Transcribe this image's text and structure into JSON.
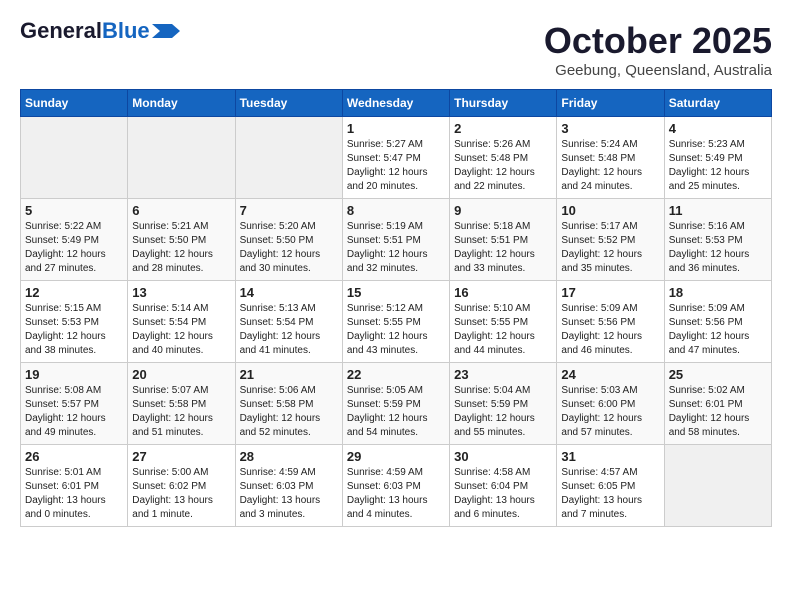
{
  "header": {
    "logo_general": "General",
    "logo_blue": "Blue",
    "month": "October 2025",
    "location": "Geebung, Queensland, Australia"
  },
  "days_of_week": [
    "Sunday",
    "Monday",
    "Tuesday",
    "Wednesday",
    "Thursday",
    "Friday",
    "Saturday"
  ],
  "weeks": [
    [
      {
        "day": "",
        "info": ""
      },
      {
        "day": "",
        "info": ""
      },
      {
        "day": "",
        "info": ""
      },
      {
        "day": "1",
        "info": "Sunrise: 5:27 AM\nSunset: 5:47 PM\nDaylight: 12 hours\nand 20 minutes."
      },
      {
        "day": "2",
        "info": "Sunrise: 5:26 AM\nSunset: 5:48 PM\nDaylight: 12 hours\nand 22 minutes."
      },
      {
        "day": "3",
        "info": "Sunrise: 5:24 AM\nSunset: 5:48 PM\nDaylight: 12 hours\nand 24 minutes."
      },
      {
        "day": "4",
        "info": "Sunrise: 5:23 AM\nSunset: 5:49 PM\nDaylight: 12 hours\nand 25 minutes."
      }
    ],
    [
      {
        "day": "5",
        "info": "Sunrise: 5:22 AM\nSunset: 5:49 PM\nDaylight: 12 hours\nand 27 minutes."
      },
      {
        "day": "6",
        "info": "Sunrise: 5:21 AM\nSunset: 5:50 PM\nDaylight: 12 hours\nand 28 minutes."
      },
      {
        "day": "7",
        "info": "Sunrise: 5:20 AM\nSunset: 5:50 PM\nDaylight: 12 hours\nand 30 minutes."
      },
      {
        "day": "8",
        "info": "Sunrise: 5:19 AM\nSunset: 5:51 PM\nDaylight: 12 hours\nand 32 minutes."
      },
      {
        "day": "9",
        "info": "Sunrise: 5:18 AM\nSunset: 5:51 PM\nDaylight: 12 hours\nand 33 minutes."
      },
      {
        "day": "10",
        "info": "Sunrise: 5:17 AM\nSunset: 5:52 PM\nDaylight: 12 hours\nand 35 minutes."
      },
      {
        "day": "11",
        "info": "Sunrise: 5:16 AM\nSunset: 5:53 PM\nDaylight: 12 hours\nand 36 minutes."
      }
    ],
    [
      {
        "day": "12",
        "info": "Sunrise: 5:15 AM\nSunset: 5:53 PM\nDaylight: 12 hours\nand 38 minutes."
      },
      {
        "day": "13",
        "info": "Sunrise: 5:14 AM\nSunset: 5:54 PM\nDaylight: 12 hours\nand 40 minutes."
      },
      {
        "day": "14",
        "info": "Sunrise: 5:13 AM\nSunset: 5:54 PM\nDaylight: 12 hours\nand 41 minutes."
      },
      {
        "day": "15",
        "info": "Sunrise: 5:12 AM\nSunset: 5:55 PM\nDaylight: 12 hours\nand 43 minutes."
      },
      {
        "day": "16",
        "info": "Sunrise: 5:10 AM\nSunset: 5:55 PM\nDaylight: 12 hours\nand 44 minutes."
      },
      {
        "day": "17",
        "info": "Sunrise: 5:09 AM\nSunset: 5:56 PM\nDaylight: 12 hours\nand 46 minutes."
      },
      {
        "day": "18",
        "info": "Sunrise: 5:09 AM\nSunset: 5:56 PM\nDaylight: 12 hours\nand 47 minutes."
      }
    ],
    [
      {
        "day": "19",
        "info": "Sunrise: 5:08 AM\nSunset: 5:57 PM\nDaylight: 12 hours\nand 49 minutes."
      },
      {
        "day": "20",
        "info": "Sunrise: 5:07 AM\nSunset: 5:58 PM\nDaylight: 12 hours\nand 51 minutes."
      },
      {
        "day": "21",
        "info": "Sunrise: 5:06 AM\nSunset: 5:58 PM\nDaylight: 12 hours\nand 52 minutes."
      },
      {
        "day": "22",
        "info": "Sunrise: 5:05 AM\nSunset: 5:59 PM\nDaylight: 12 hours\nand 54 minutes."
      },
      {
        "day": "23",
        "info": "Sunrise: 5:04 AM\nSunset: 5:59 PM\nDaylight: 12 hours\nand 55 minutes."
      },
      {
        "day": "24",
        "info": "Sunrise: 5:03 AM\nSunset: 6:00 PM\nDaylight: 12 hours\nand 57 minutes."
      },
      {
        "day": "25",
        "info": "Sunrise: 5:02 AM\nSunset: 6:01 PM\nDaylight: 12 hours\nand 58 minutes."
      }
    ],
    [
      {
        "day": "26",
        "info": "Sunrise: 5:01 AM\nSunset: 6:01 PM\nDaylight: 13 hours\nand 0 minutes."
      },
      {
        "day": "27",
        "info": "Sunrise: 5:00 AM\nSunset: 6:02 PM\nDaylight: 13 hours\nand 1 minute."
      },
      {
        "day": "28",
        "info": "Sunrise: 4:59 AM\nSunset: 6:03 PM\nDaylight: 13 hours\nand 3 minutes."
      },
      {
        "day": "29",
        "info": "Sunrise: 4:59 AM\nSunset: 6:03 PM\nDaylight: 13 hours\nand 4 minutes."
      },
      {
        "day": "30",
        "info": "Sunrise: 4:58 AM\nSunset: 6:04 PM\nDaylight: 13 hours\nand 6 minutes."
      },
      {
        "day": "31",
        "info": "Sunrise: 4:57 AM\nSunset: 6:05 PM\nDaylight: 13 hours\nand 7 minutes."
      },
      {
        "day": "",
        "info": ""
      }
    ]
  ]
}
